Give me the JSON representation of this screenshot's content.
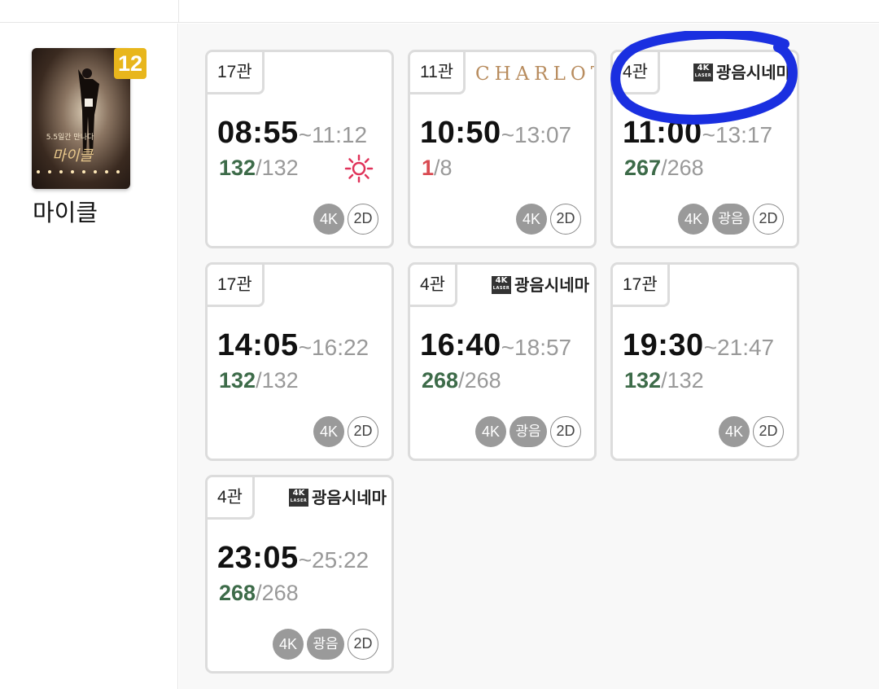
{
  "movie": {
    "title": "마이클",
    "age_rating": "12",
    "poster": {
      "title_text": "마이클",
      "tagline": "5.5일간 만나다"
    }
  },
  "showtimes": [
    {
      "hall": "17관",
      "brand": "",
      "start": "08:55",
      "end": "~11:12",
      "available": "132",
      "total": "/132",
      "morning_icon": "sun-icon",
      "badges": [
        "4K",
        "2D"
      ]
    },
    {
      "hall": "11관",
      "brand": "CHARLOTTE",
      "start": "10:50",
      "end": "~13:07",
      "available": "1",
      "total": "/8",
      "badges": [
        "4K",
        "2D"
      ]
    },
    {
      "hall": "4관",
      "brand": "광음시네마",
      "brand_logo_top": "4K",
      "brand_logo_bottom": "LASER",
      "start": "11:00",
      "end": "~13:17",
      "available": "267",
      "total": "/268",
      "badges": [
        "4K",
        "광음",
        "2D"
      ]
    },
    {
      "hall": "17관",
      "brand": "",
      "start": "14:05",
      "end": "~16:22",
      "available": "132",
      "total": "/132",
      "badges": [
        "4K",
        "2D"
      ]
    },
    {
      "hall": "4관",
      "brand": "광음시네마",
      "brand_logo_top": "4K",
      "brand_logo_bottom": "LASER",
      "start": "16:40",
      "end": "~18:57",
      "available": "268",
      "total": "/268",
      "badges": [
        "4K",
        "광음",
        "2D"
      ]
    },
    {
      "hall": "17관",
      "brand": "",
      "start": "19:30",
      "end": "~21:47",
      "available": "132",
      "total": "/132",
      "badges": [
        "4K",
        "2D"
      ]
    },
    {
      "hall": "4관",
      "brand": "광음시네마",
      "brand_logo_top": "4K",
      "brand_logo_bottom": "LASER",
      "start": "23:05",
      "end": "~25:22",
      "available": "268",
      "total": "/268",
      "badges": [
        "4K",
        "광음",
        "2D"
      ]
    }
  ],
  "colors": {
    "available_seats": "#3d6b49",
    "low_seats": "#d94b52",
    "age_badge": "#e8b61c",
    "annotation_circle": "#1a2fe0",
    "sun_icon": "#e0335a"
  }
}
